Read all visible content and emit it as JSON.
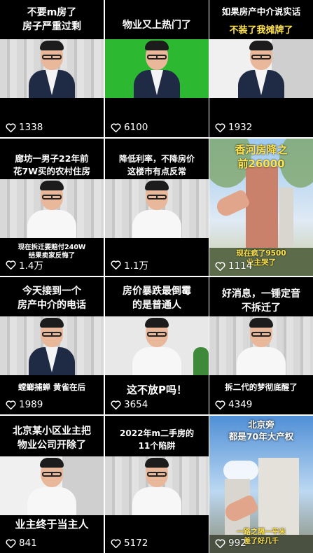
{
  "videos": [
    {
      "title": "不要m房了\n房子严重过剩",
      "likes": "1338"
    },
    {
      "title": "物业又上热门了",
      "likes": "6100"
    },
    {
      "title": "如果房产中介说实话",
      "subtitle": "不装了我摊牌了",
      "likes": "1932"
    },
    {
      "title": "廊坊一男子22年前\n花7W买的农村住房",
      "caption": "现在拆迁要赔付240W\n结果卖家反悔了",
      "likes": "1.4万"
    },
    {
      "title": "降低利率，不降房价\n这楼市有点反常",
      "likes": "1.1万"
    },
    {
      "title": "香河房降之\n前26000",
      "caption": "现在疯了9500\n业主哭了",
      "likes": "1114"
    },
    {
      "title": "今天接到一个\n房产中介的电话",
      "caption": "螳螂捕蝉 黄雀在后",
      "likes": "1989"
    },
    {
      "title": "房价暴跌最倒霉\n的是普通人",
      "caption": "这不放P吗！",
      "likes": "3654"
    },
    {
      "title": "好消息，一锤定音\n不拆迁了",
      "caption": "拆二代的梦彻底醒了",
      "likes": "4349"
    },
    {
      "title": "北京某小区业主把\n物业公司开除了",
      "caption": "业主终于当主人",
      "likes": "841"
    },
    {
      "title": "2022年m二手房的\n11个陷阱",
      "likes": "5172"
    },
    {
      "title": "北京旁\n都是70年大产权",
      "caption": "一路之隔一平米\n差了好几千",
      "likes": "992"
    }
  ]
}
